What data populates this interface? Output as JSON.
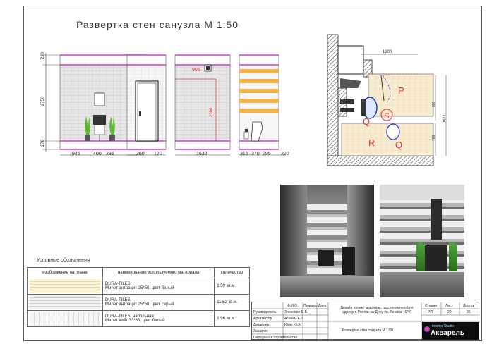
{
  "title": "Развертка стен санузла М 1:50",
  "elevations": {
    "left_vertical_dims": [
      "220",
      "2750",
      "270"
    ],
    "bottom_dims_1": [
      "945",
      "400",
      "286"
    ],
    "bottom_dims_2": [
      "260",
      "120"
    ],
    "dim_905": "905",
    "dim_2390": "2390",
    "bottom_dims_3": [
      "1632"
    ],
    "bottom_dims_4": [
      "315",
      "370",
      "295",
      "220"
    ]
  },
  "plan": {
    "dims": [
      "1200",
      "930",
      "1632",
      "700"
    ],
    "markers": [
      "Q",
      "P",
      "S",
      "R",
      "Q"
    ],
    "colors": {
      "marker": "#e0312e",
      "tile_beige": "#f3e2b8",
      "wall": "#222222"
    }
  },
  "legend": {
    "heading": "Условные обозначения",
    "columns": [
      "изображение на плане",
      "наименование используемого материала",
      "количество"
    ],
    "rows": [
      {
        "material": "DURA-TILES,\nМилет антрацит 25*50, цвет белый",
        "qty": "1,59 кв.м."
      },
      {
        "material": "DURA-TILES,\nМилет антрацит 25*50, цвет серый",
        "qty": "11,52 кв.м."
      },
      {
        "material": "DURA-TILES, напольная\nМилет вайт 33*33, цвет белый",
        "qty": "1,96 кв.м."
      }
    ]
  },
  "stamp": {
    "head_fio": "Ф.И.О.",
    "head_sign": "Подпись",
    "head_date": "Дата",
    "roles": [
      {
        "role": "Руководитель",
        "name": "Зинновин Е.В."
      },
      {
        "role": "Архитектор",
        "name": "Асанин А. Г."
      },
      {
        "role": "Дизайнер",
        "name": "Юлю Ю.А."
      },
      {
        "role": "Заказчик",
        "name": ""
      },
      {
        "role": "Передано в строительство",
        "name": ""
      }
    ],
    "project": "Дизайн проект квартиры, расположенной по адресу г. Ростов-на-Дону ул. Ленина 40\"б\"",
    "sheet_title": "Развертка стен санузла М 1:50",
    "stage_label": "Стадия",
    "sheet_label": "Лист",
    "sheets_label": "Листов",
    "stage": "РП",
    "sheet": "20",
    "sheets": "35",
    "logo_small": "Interior Studio",
    "logo_name": "Акварель"
  },
  "colors": {
    "accent_magenta": "#d63ad6",
    "tile_orange": "#f2b24a",
    "plant_green": "#5fb82e"
  }
}
